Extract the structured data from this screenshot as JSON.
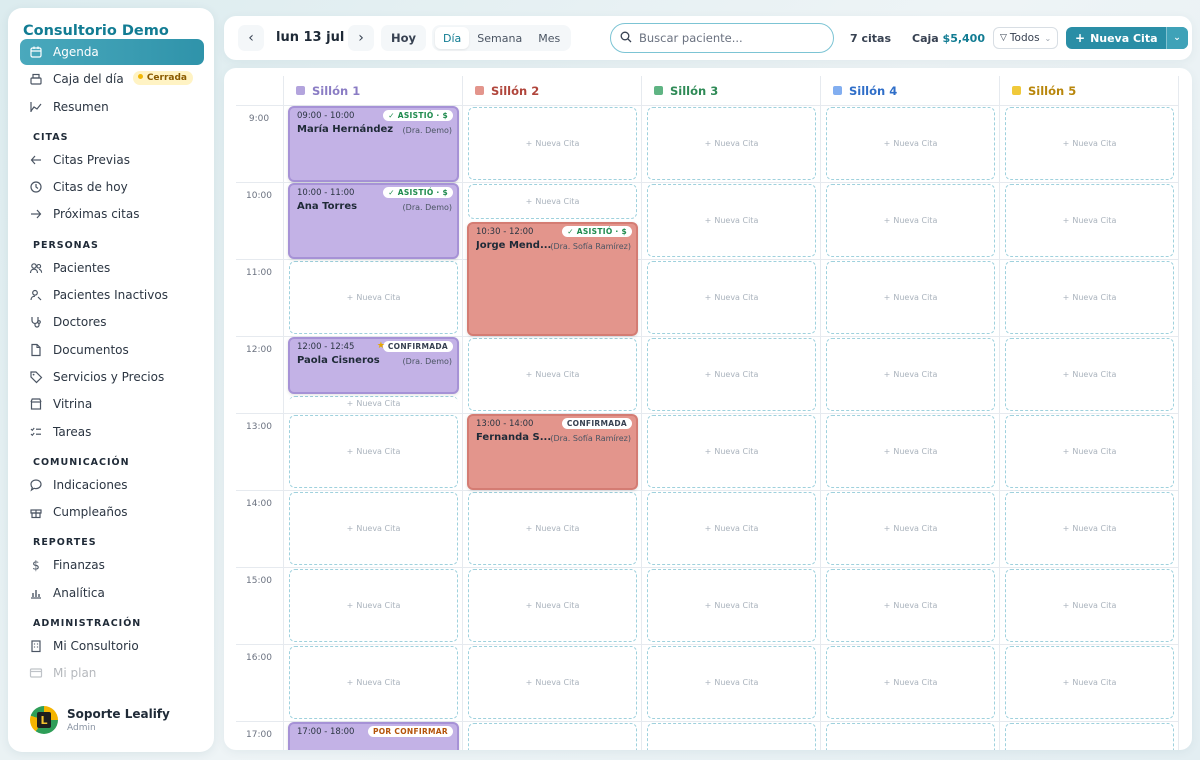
{
  "app": {
    "brand": "Consultorio Demo"
  },
  "sidebar": {
    "top_items": [
      {
        "label": "Agenda",
        "icon": "calendar-icon",
        "active": true
      },
      {
        "label": "Caja del día",
        "icon": "cash-register-icon",
        "badge": "Cerrada"
      },
      {
        "label": "Resumen",
        "icon": "trend-chart-icon"
      }
    ],
    "sections": [
      {
        "title": "CITAS",
        "items": [
          {
            "label": "Citas Previas",
            "icon": "arrow-left-icon"
          },
          {
            "label": "Citas de hoy",
            "icon": "clock-icon"
          },
          {
            "label": "Próximas citas",
            "icon": "arrow-right-icon"
          }
        ]
      },
      {
        "title": "PERSONAS",
        "items": [
          {
            "label": "Pacientes",
            "icon": "users-icon"
          },
          {
            "label": "Pacientes Inactivos",
            "icon": "user-inactive-icon"
          },
          {
            "label": "Doctores",
            "icon": "stethoscope-icon"
          },
          {
            "label": "Documentos",
            "icon": "document-icon"
          },
          {
            "label": "Servicios y Precios",
            "icon": "tag-icon"
          },
          {
            "label": "Vitrina",
            "icon": "storefront-icon"
          },
          {
            "label": "Tareas",
            "icon": "tasks-icon"
          }
        ]
      },
      {
        "title": "COMUNICACIÓN",
        "items": [
          {
            "label": "Indicaciones",
            "icon": "chat-bubble-icon"
          },
          {
            "label": "Cumpleaños",
            "icon": "gift-icon"
          }
        ]
      },
      {
        "title": "REPORTES",
        "items": [
          {
            "label": "Finanzas",
            "icon": "dollar-icon"
          },
          {
            "label": "Analítica",
            "icon": "bar-chart-icon"
          }
        ]
      },
      {
        "title": "ADMINISTRACIÓN",
        "items": [
          {
            "label": "Mi Consultorio",
            "icon": "building-icon"
          },
          {
            "label": "Mi plan",
            "icon": "card-icon"
          }
        ]
      }
    ],
    "user": {
      "name": "Soporte Lealify",
      "role": "Admin",
      "avatar_letter": "L"
    }
  },
  "toolbar": {
    "prev_icon": "chevron-left-icon",
    "date": "lun 13 jul",
    "next_icon": "chevron-right-icon",
    "today": "Hoy",
    "views": [
      "Día",
      "Semana",
      "Mes"
    ],
    "active_view": "Día",
    "search_placeholder": "Buscar paciente...",
    "appointments_count": "7 citas",
    "cash_label": "Caja",
    "cash_value": "$5,400",
    "filter": "Todos",
    "new_button": "Nueva Cita"
  },
  "calendar": {
    "chairs": [
      {
        "name": "Sillón 1",
        "color": "#b3a4dd",
        "text_color": "#8a7cc4"
      },
      {
        "name": "Sillón 2",
        "color": "#e3958c",
        "text_color": "#b0453b"
      },
      {
        "name": "Sillón 3",
        "color": "#5fb483",
        "text_color": "#2e8a56"
      },
      {
        "name": "Sillón 4",
        "color": "#82aef0",
        "text_color": "#2f6ec8"
      },
      {
        "name": "Sillón 5",
        "color": "#f0c93a",
        "text_color": "#b8860b"
      }
    ],
    "hours": [
      "9:00",
      "10:00",
      "11:00",
      "12:00",
      "13:00",
      "14:00",
      "15:00",
      "16:00",
      "17:00"
    ],
    "empty_slot_label": "Nueva Cita",
    "appointments": [
      {
        "chair": 0,
        "start": 9,
        "end": 10,
        "time": "09:00 - 10:00",
        "patient": "María Hernández",
        "doctor": "(Dra. Demo)",
        "status": "✓ ASISTIÓ · $",
        "status_color": "green",
        "color": "purple"
      },
      {
        "chair": 0,
        "start": 10,
        "end": 11,
        "time": "10:00 - 11:00",
        "patient": "Ana Torres",
        "doctor": "(Dra. Demo)",
        "status": "✓ ASISTIÓ · $",
        "status_color": "green",
        "color": "purple"
      },
      {
        "chair": 1,
        "start": 10.5,
        "end": 12,
        "time": "10:30 - 12:00",
        "patient": "Jorge Mend...",
        "doctor": "(Dra. Sofía Ramírez)",
        "status": "✓ ASISTIÓ · $",
        "status_color": "green",
        "color": "red"
      },
      {
        "chair": 0,
        "start": 12,
        "end": 12.75,
        "time": "12:00 - 12:45",
        "patient": "Paola Cisneros",
        "doctor": "(Dra. Demo)",
        "status": "CONFIRMADA",
        "status_color": "dark",
        "color": "purple",
        "star": true
      },
      {
        "chair": 1,
        "start": 13,
        "end": 14,
        "time": "13:00 - 14:00",
        "patient": "Fernanda S...",
        "doctor": "(Dra. Sofía Ramírez)",
        "status": "CONFIRMADA",
        "status_color": "dark",
        "color": "red"
      },
      {
        "chair": 0,
        "start": 17,
        "end": 18,
        "time": "17:00 - 18:00",
        "patient": "",
        "doctor": "",
        "status": "POR CONFIRMAR",
        "status_color": "orange",
        "color": "purple"
      }
    ],
    "empty_slots": [
      {
        "chair": 0,
        "start": 11,
        "end": 12
      },
      {
        "chair": 0,
        "start": 12.75,
        "end": 13,
        "small": true
      },
      {
        "chair": 0,
        "start": 13,
        "end": 14
      },
      {
        "chair": 0,
        "start": 14,
        "end": 15
      },
      {
        "chair": 0,
        "start": 15,
        "end": 16
      },
      {
        "chair": 0,
        "start": 16,
        "end": 17
      },
      {
        "chair": 1,
        "start": 9,
        "end": 10
      },
      {
        "chair": 1,
        "start": 10,
        "end": 10.5
      },
      {
        "chair": 1,
        "start": 12,
        "end": 13
      },
      {
        "chair": 1,
        "start": 14,
        "end": 15
      },
      {
        "chair": 1,
        "start": 15,
        "end": 16
      },
      {
        "chair": 1,
        "start": 16,
        "end": 17
      },
      {
        "chair": 1,
        "start": 17,
        "end": 18
      },
      {
        "chair": 2,
        "start": 9,
        "end": 10
      },
      {
        "chair": 2,
        "start": 10,
        "end": 11
      },
      {
        "chair": 2,
        "start": 11,
        "end": 12
      },
      {
        "chair": 2,
        "start": 12,
        "end": 13
      },
      {
        "chair": 2,
        "start": 13,
        "end": 14
      },
      {
        "chair": 2,
        "start": 14,
        "end": 15
      },
      {
        "chair": 2,
        "start": 15,
        "end": 16
      },
      {
        "chair": 2,
        "start": 16,
        "end": 17
      },
      {
        "chair": 2,
        "start": 17,
        "end": 18
      },
      {
        "chair": 3,
        "start": 9,
        "end": 10
      },
      {
        "chair": 3,
        "start": 10,
        "end": 11
      },
      {
        "chair": 3,
        "start": 11,
        "end": 12
      },
      {
        "chair": 3,
        "start": 12,
        "end": 13
      },
      {
        "chair": 3,
        "start": 13,
        "end": 14
      },
      {
        "chair": 3,
        "start": 14,
        "end": 15
      },
      {
        "chair": 3,
        "start": 15,
        "end": 16
      },
      {
        "chair": 3,
        "start": 16,
        "end": 17
      },
      {
        "chair": 3,
        "start": 17,
        "end": 18
      },
      {
        "chair": 4,
        "start": 9,
        "end": 10
      },
      {
        "chair": 4,
        "start": 10,
        "end": 11
      },
      {
        "chair": 4,
        "start": 11,
        "end": 12
      },
      {
        "chair": 4,
        "start": 12,
        "end": 13
      },
      {
        "chair": 4,
        "start": 13,
        "end": 14
      },
      {
        "chair": 4,
        "start": 14,
        "end": 15
      },
      {
        "chair": 4,
        "start": 15,
        "end": 16
      },
      {
        "chair": 4,
        "start": 16,
        "end": 17
      },
      {
        "chair": 4,
        "start": 17,
        "end": 18
      }
    ]
  }
}
